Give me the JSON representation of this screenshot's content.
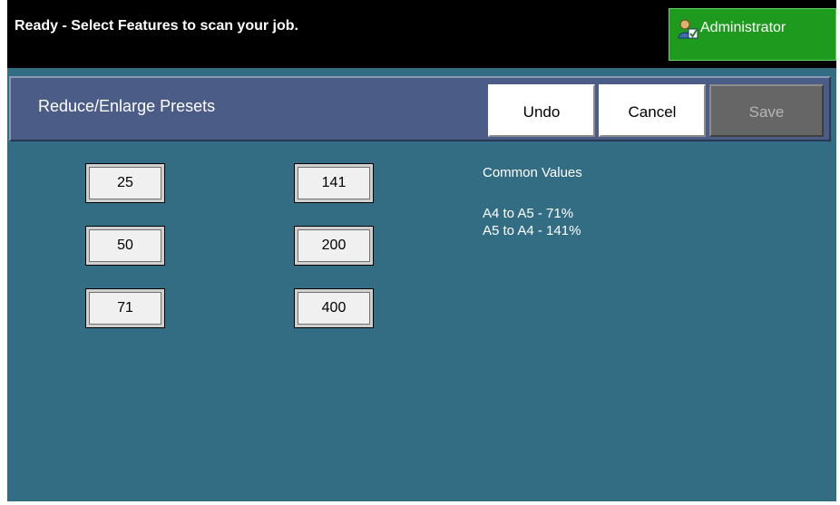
{
  "status_bar": {
    "message": "Ready - Select Features to scan your job.",
    "admin_label": "Administrator"
  },
  "header": {
    "title": "Reduce/Enlarge Presets",
    "undo_label": "Undo",
    "cancel_label": "Cancel",
    "save_label": "Save"
  },
  "presets": {
    "left": [
      "25",
      "50",
      "71"
    ],
    "right": [
      "141",
      "200",
      "400"
    ]
  },
  "info": {
    "heading": "Common Values",
    "line1": "A4 to A5 - 71%",
    "line2": "A5 to A4 - 141%"
  },
  "colors": {
    "admin_green": "#1e9b1e",
    "panel_teal": "#336d84",
    "header_blue": "#4b5c86",
    "save_disabled": "#666666"
  },
  "icons": {
    "admin": "admin-user-icon"
  }
}
